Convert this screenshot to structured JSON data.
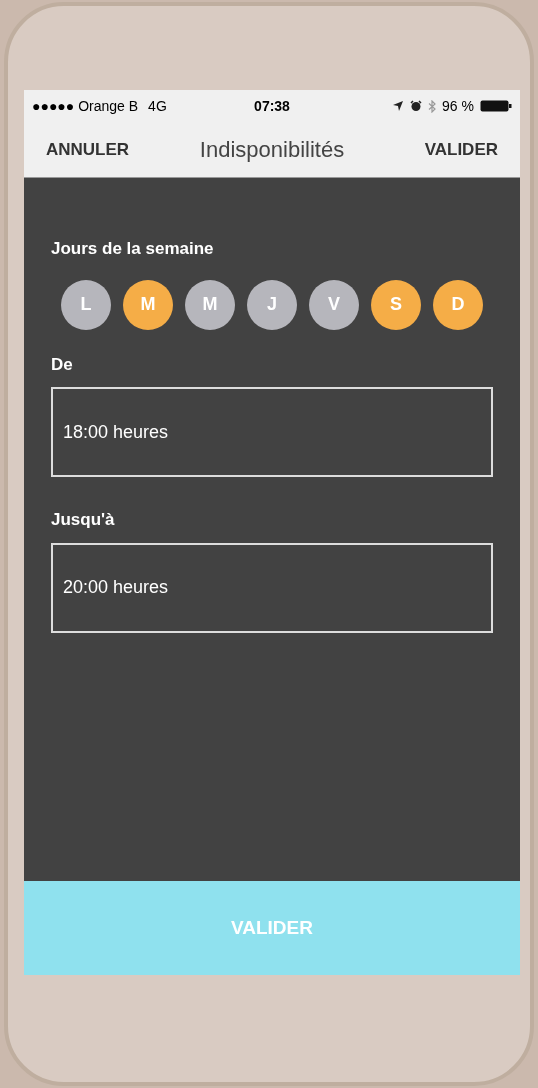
{
  "status_bar": {
    "carrier": "●●●●● Orange B",
    "network": "4G",
    "time": "07:38",
    "battery": "96 %"
  },
  "nav": {
    "cancel": "ANNULER",
    "title": "Indisponibilités",
    "confirm": "VALIDER"
  },
  "days_label": "Jours de la semaine",
  "days": [
    {
      "label": "L",
      "selected": false
    },
    {
      "label": "M",
      "selected": true
    },
    {
      "label": "M",
      "selected": false
    },
    {
      "label": "J",
      "selected": false
    },
    {
      "label": "V",
      "selected": false
    },
    {
      "label": "S",
      "selected": true
    },
    {
      "label": "D",
      "selected": true
    }
  ],
  "from": {
    "label": "De",
    "value": "18:00 heures"
  },
  "to": {
    "label": "Jusqu'à",
    "value": "20:00 heures"
  },
  "submit": "VALIDER"
}
